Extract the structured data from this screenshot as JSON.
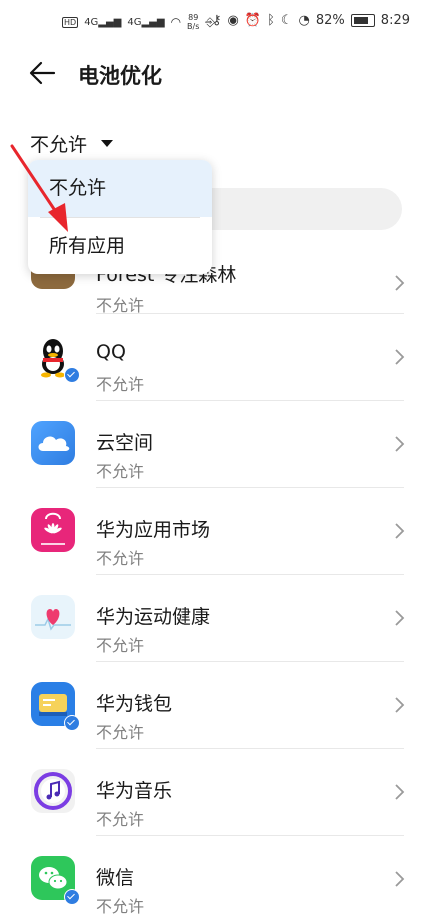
{
  "status_bar": {
    "left_icons": [
      "hd-icon",
      "4g-signal-icon",
      "4g-signal-icon",
      "wifi-icon"
    ],
    "net_speed_value": "89",
    "net_speed_unit": "B/s",
    "usb_icon": "usb-icon",
    "right_icons": [
      "key-icon",
      "eye-icon",
      "alarm-icon",
      "bluetooth-icon",
      "moon-icon",
      "speed-icon"
    ],
    "battery": "82%",
    "time": "8:29"
  },
  "header": {
    "title": "电池优化",
    "back_icon": "back-arrow-icon"
  },
  "filter": {
    "selected": "不允许"
  },
  "dropdown": {
    "options": [
      "不允许",
      "所有应用"
    ]
  },
  "apps": [
    {
      "name": "Forest 专注森林",
      "status": "不允许",
      "icon": "forest-icon",
      "badge": false,
      "colors": [
        "#f3efcf",
        "#b9d268"
      ]
    },
    {
      "name": "QQ",
      "status": "不允许",
      "icon": "qq-icon",
      "badge": true,
      "colors": [
        "#ffffff",
        "#111111"
      ]
    },
    {
      "name": "云空间",
      "status": "不允许",
      "icon": "cloud-icon",
      "badge": false,
      "colors": [
        "#3a8df5",
        "#ffffff"
      ]
    },
    {
      "name": "华为应用市场",
      "status": "不允许",
      "icon": "appgallery-icon",
      "badge": false,
      "colors": [
        "#e8267a",
        "#ffffff"
      ]
    },
    {
      "name": "华为运动健康",
      "status": "不允许",
      "icon": "health-icon",
      "badge": false,
      "colors": [
        "#e8f4fb",
        "#ee3b6e"
      ]
    },
    {
      "name": "华为钱包",
      "status": "不允许",
      "icon": "wallet-icon",
      "badge": true,
      "colors": [
        "#2a7fe6",
        "#f6d25a"
      ]
    },
    {
      "name": "华为音乐",
      "status": "不允许",
      "icon": "music-icon",
      "badge": false,
      "colors": [
        "#f1f1f1",
        "#7b3de3"
      ]
    },
    {
      "name": "微信",
      "status": "不允许",
      "icon": "wechat-icon",
      "badge": true,
      "colors": [
        "#2ec75b",
        "#ffffff"
      ]
    }
  ],
  "annotation": {
    "color": "#e8262d"
  }
}
